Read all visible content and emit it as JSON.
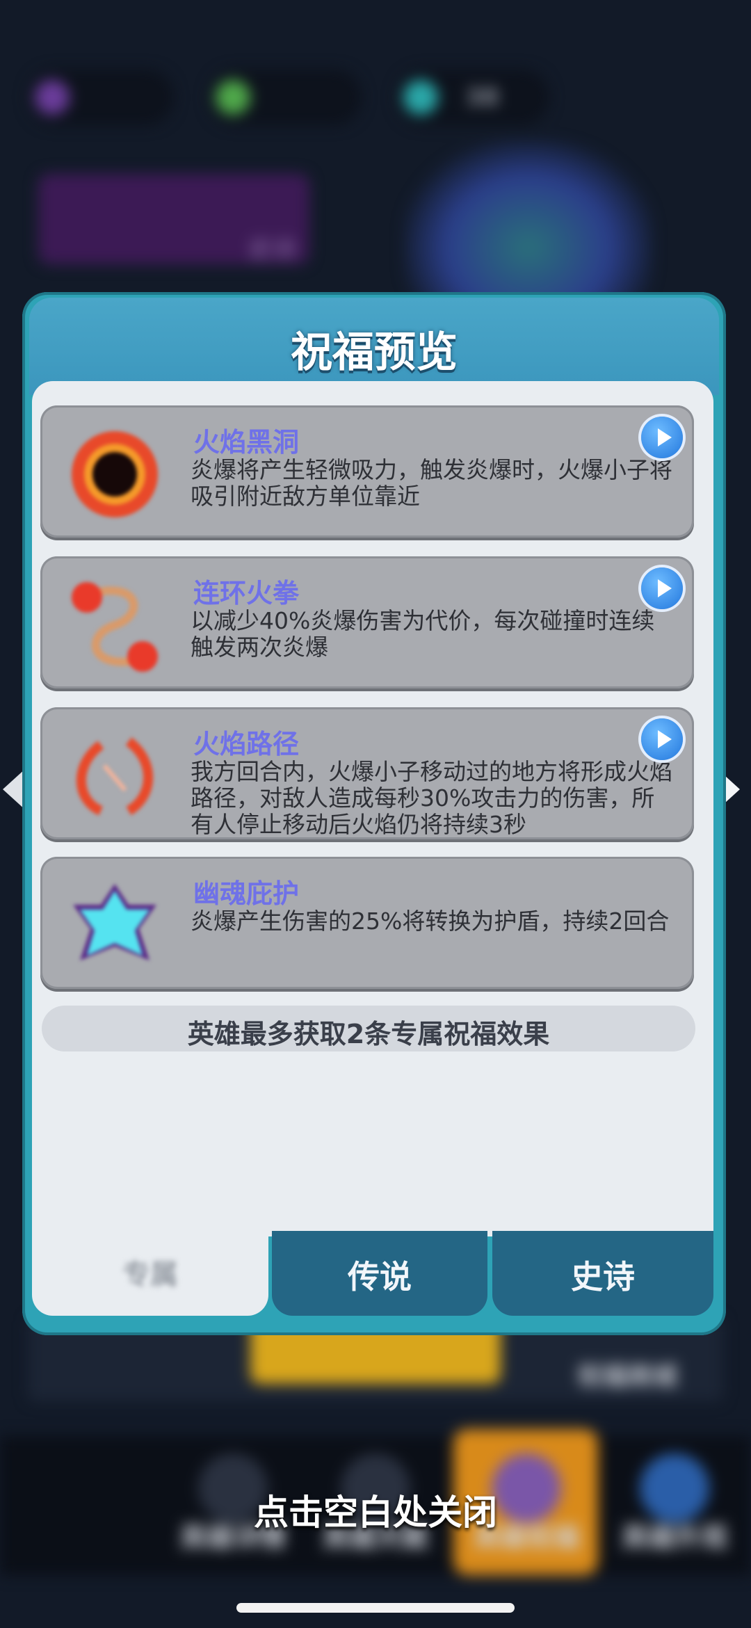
{
  "background": {
    "resources": [
      "",
      "",
      "38"
    ],
    "hero_name": "",
    "hero_rarity": "史诗",
    "yellow_button": "",
    "shop_label": "祝福商城",
    "nav": [
      {
        "label": "英雄详情"
      },
      {
        "label": "英雄天赋"
      },
      {
        "label": "英雄祝福"
      },
      {
        "label": "英雄外观"
      }
    ]
  },
  "modal": {
    "title": "祝福预览",
    "cards": [
      {
        "name": "火焰黑洞",
        "desc": "炎爆将产生轻微吸力，触发炎爆时，火爆小子将吸引附近敌方单位靠近",
        "icon": "black-hole-icon",
        "has_play": true
      },
      {
        "name": "连环火拳",
        "desc": "以减少40%炎爆伤害为代价，每次碰撞时连续触发两次炎爆",
        "icon": "fire-fist-icon",
        "has_play": true
      },
      {
        "name": "火焰路径",
        "desc": "我方回合内，火爆小子移动过的地方将形成火焰路径，对敌人造成每秒30%攻击力的伤害，所有人停止移动后火焰仍将持续3秒",
        "icon": "fire-path-icon",
        "has_play": true
      },
      {
        "name": "幽魂庇护",
        "desc": "炎爆产生伤害的25%将转换为护盾，持续2回合",
        "icon": "ghost-shield-icon",
        "has_play": false
      }
    ],
    "footer_note": "英雄最多获取2条专属祝福效果",
    "tabs": [
      {
        "label": "专属"
      },
      {
        "label": "传说"
      },
      {
        "label": "史诗"
      }
    ]
  },
  "close_hint": "点击空白处关闭",
  "colors": {
    "accent_blue": "#246685",
    "card_name": "#6f71e8",
    "modal_frame": "#2ea3b6"
  }
}
